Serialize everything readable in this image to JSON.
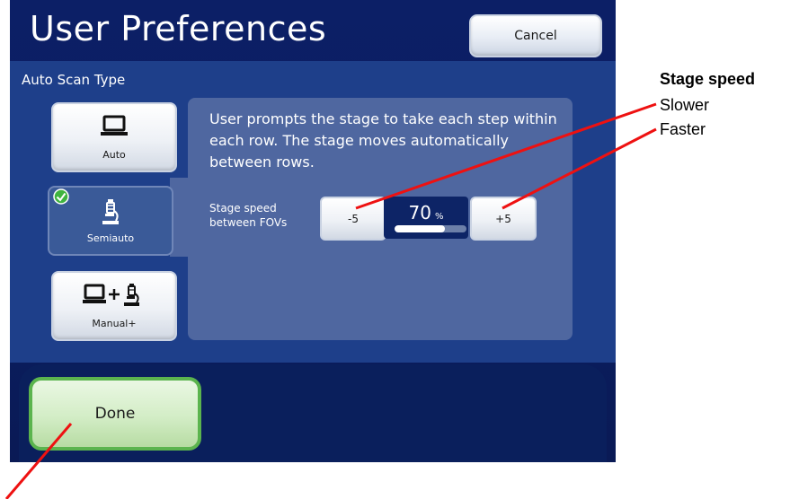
{
  "window": {
    "title": "User Preferences",
    "cancel_label": "Cancel"
  },
  "scan_type": {
    "section_label": "Auto Scan Type",
    "options": [
      {
        "label": "Auto",
        "icon": "monitor-icon",
        "selected": false
      },
      {
        "label": "Semiauto",
        "icon": "microscope-icon",
        "selected": true
      },
      {
        "label": "Manual+",
        "icon": "monitor-plus-microscope-icon",
        "selected": false
      }
    ]
  },
  "panel": {
    "description": "User prompts the stage to take each step within each row.   The stage moves automatically between rows.",
    "speed_label": "Stage speed between FOVs",
    "decrease_label": "-5",
    "increase_label": "+5",
    "speed_value": "70",
    "speed_unit": "%",
    "speed_fraction": 0.7
  },
  "footer": {
    "done_label": "Done"
  },
  "annotations": {
    "title": "Stage speed",
    "slower": "Slower",
    "faster": "Faster"
  },
  "colors": {
    "accent_line": "#ee1111",
    "check_green": "#3fb33f"
  }
}
